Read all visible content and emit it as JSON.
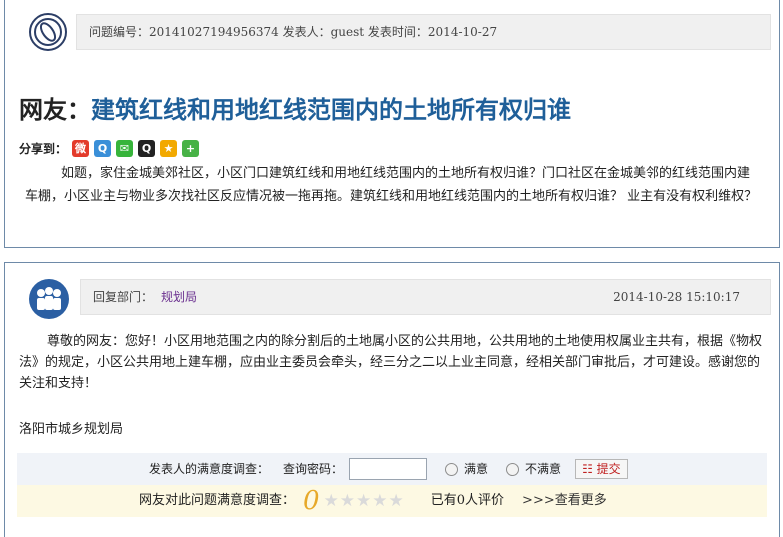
{
  "question": {
    "meta": "问题编号：20141027194956374  发表人：guest  发表时间：2014-10-27",
    "title_prefix": "网友：",
    "title": "建筑红线和用地红线范围内的土地所有权归谁",
    "share_label": "分享到：",
    "share_icons": [
      "weibo-icon",
      "qzone-icon",
      "wechat-icon",
      "qq-icon",
      "star-icon",
      "plus-icon"
    ],
    "body": "如题，家住金城美郊社区，小区门口建筑红线和用地红线范围内的土地所有权归谁？门口社区在金城美邻的红线范围内建车棚，小区业主与物业多次找社区反应情况被一拖再拖。建筑红线和用地红线范围内的土地所有权归谁？ 业主有没有权利维权？"
  },
  "reply": {
    "dept_label": "回复部门：",
    "dept_name": "规划局",
    "time": "2014-10-28 15:10:17",
    "body": "尊敬的网友：您好！小区用地范围之内的除分割后的土地属小区的公共用地，公共用地的土地使用权属业主共有，根据《物权法》的规定，小区公共用地上建车棚，应由业主委员会牵头，经三分之二以上业主同意，经相关部门审批后，才可建设。感谢您的关注和支持！",
    "signature": "洛阳市城乡规划局"
  },
  "survey": {
    "poster_label": "发表人的满意度调查：",
    "password_label": "查询密码：",
    "password_value": "",
    "opt_satisfied": "满意",
    "opt_unsatisfied": "不满意",
    "submit_label": "提交",
    "public_label": "网友对此问题满意度调查：",
    "score": "0",
    "stars": "★★★★★",
    "rated_text": "已有0人评价",
    "more_link": ">>>查看更多"
  }
}
